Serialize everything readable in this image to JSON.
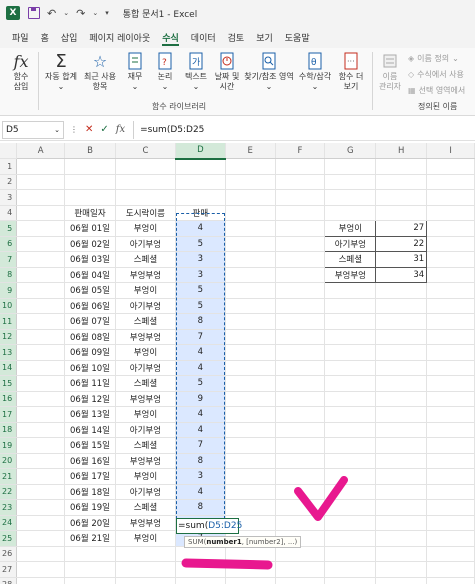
{
  "app": {
    "doc_title": "통합 문서1  -  Excel"
  },
  "menu": {
    "tabs": [
      "파일",
      "홈",
      "삽입",
      "페이지 레이아웃",
      "수식",
      "데이터",
      "검토",
      "보기",
      "도움말"
    ],
    "active_index": 4
  },
  "ribbon": {
    "buttons": [
      {
        "label1": "함수",
        "label2": "삽입",
        "icon": "fx-icon"
      },
      {
        "label1": "자동 합계",
        "label2": "",
        "icon": "sigma-icon"
      },
      {
        "label1": "최근 사용",
        "label2": "항목",
        "icon": "star-icon"
      },
      {
        "label1": "재무",
        "label2": "",
        "icon": "finance-icon"
      },
      {
        "label1": "논리",
        "label2": "",
        "icon": "logic-icon"
      },
      {
        "label1": "텍스트",
        "label2": "",
        "icon": "text-icon"
      },
      {
        "label1": "날짜 및",
        "label2": "시간",
        "icon": "clock-icon"
      },
      {
        "label1": "찾기/참조 영역",
        "label2": "",
        "icon": "lookup-icon"
      },
      {
        "label1": "수학/삼각",
        "label2": "",
        "icon": "math-icon"
      },
      {
        "label1": "함수 더",
        "label2": "보기",
        "icon": "more-icon"
      }
    ],
    "group_library": "함수 라이브러리",
    "name_manager": {
      "label1": "이름",
      "label2": "관리자"
    },
    "define_name": "이름 정의",
    "use_in_formula": "수식에서 사용",
    "create_from_selection": "선택 영역에서",
    "group_names": "정의된 이름"
  },
  "formula_bar": {
    "name_box": "D5",
    "formula": "=sum(D5:D25"
  },
  "sheet": {
    "columns": [
      "A",
      "B",
      "C",
      "D",
      "E",
      "F",
      "G",
      "H",
      "I"
    ],
    "selected_column": "D",
    "header_row": {
      "date": "판매일자",
      "name": "도시락이름",
      "sales": "판매"
    },
    "rows": [
      {
        "date": "06월 01일",
        "name": "부엉이",
        "sales": "4"
      },
      {
        "date": "06월 02일",
        "name": "아기부엉",
        "sales": "5"
      },
      {
        "date": "06월 03일",
        "name": "스페셜",
        "sales": "3"
      },
      {
        "date": "06월 04일",
        "name": "부엉부엉",
        "sales": "3"
      },
      {
        "date": "06월 05일",
        "name": "부엉이",
        "sales": "5"
      },
      {
        "date": "06월 06일",
        "name": "아기부엉",
        "sales": "5"
      },
      {
        "date": "06월 07일",
        "name": "스페셜",
        "sales": "8"
      },
      {
        "date": "06월 08일",
        "name": "부엉부엉",
        "sales": "7"
      },
      {
        "date": "06월 09일",
        "name": "부엉이",
        "sales": "4"
      },
      {
        "date": "06월 10일",
        "name": "아기부엉",
        "sales": "4"
      },
      {
        "date": "06월 11일",
        "name": "스페셜",
        "sales": "5"
      },
      {
        "date": "06월 12일",
        "name": "부엉부엉",
        "sales": "9"
      },
      {
        "date": "06월 13일",
        "name": "부엉이",
        "sales": "4"
      },
      {
        "date": "06월 14일",
        "name": "아기부엉",
        "sales": "4"
      },
      {
        "date": "06월 15일",
        "name": "스페셜",
        "sales": "7"
      },
      {
        "date": "06월 16일",
        "name": "부엉부엉",
        "sales": "8"
      },
      {
        "date": "06월 17일",
        "name": "부엉이",
        "sales": "3"
      },
      {
        "date": "06월 18일",
        "name": "아기부엉",
        "sales": "4"
      },
      {
        "date": "06월 19일",
        "name": "스페셜",
        "sales": "8"
      },
      {
        "date": "06월 20일",
        "name": "부엉부엉",
        "sales": "7"
      },
      {
        "date": "06월 21일",
        "name": "부엉이",
        "sales": "7"
      }
    ],
    "summary": [
      {
        "name": "부엉이",
        "total": "27"
      },
      {
        "name": "아기부엉",
        "total": "22"
      },
      {
        "name": "스페셜",
        "total": "31"
      },
      {
        "name": "부엉부엉",
        "total": "34"
      }
    ],
    "edit_cell": {
      "prefix": "=sum(",
      "ref": "D5:D25"
    },
    "tooltip": {
      "func": "SUM(",
      "arg1": "number1",
      "rest": ", [number2], ...)"
    },
    "colors": {
      "accent": "#1d6f42",
      "select_fill": "#dbe8ff",
      "pen": "#e8188f"
    }
  }
}
